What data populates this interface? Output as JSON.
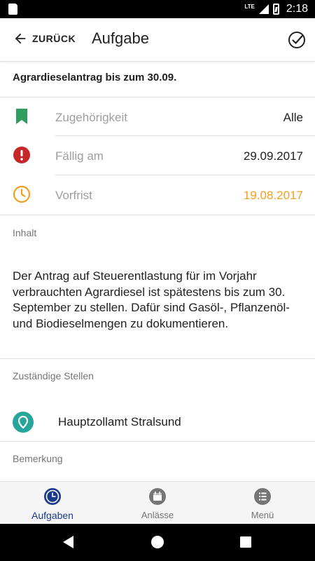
{
  "status_bar": {
    "network": "LTE",
    "time": "2:18"
  },
  "app_bar": {
    "back_label": "ZURÜCK",
    "title": "Aufgabe",
    "action_icon": "check-circle-icon"
  },
  "task": {
    "title": "Agrardieselantrag bis zum 30.09.",
    "rows": [
      {
        "icon": "bookmark-icon",
        "icon_color": "#2e9d5e",
        "label": "Zugehörigkeit",
        "value": "Alle",
        "value_color": "#212121"
      },
      {
        "icon": "alert-icon",
        "icon_color": "#c62828",
        "label": "Fällig am",
        "value": "29.09.2017",
        "value_color": "#212121"
      },
      {
        "icon": "clock-icon",
        "icon_color": "#f0a020",
        "label": "Vorfrist",
        "value": "19.08.2017",
        "value_color": "#f0a020"
      }
    ],
    "content_label": "Inhalt",
    "content_text": "Der Antrag auf Steuerentlastung für im Vorjahr verbrauchten Agrardiesel ist spätestens bis zum 30. September zu stellen. Dafür sind Gasöl-, Pflanzenöl- und Biodieselmengen zu dokumentieren.",
    "responsible_label": "Zuständige Stellen",
    "responsible_name": "Hauptzollamt Stralsund",
    "remark_label": "Bemerkung"
  },
  "bottom_nav": {
    "tabs": [
      {
        "label": "Aufgaben",
        "icon": "clock-icon",
        "active": true
      },
      {
        "label": "Anlässe",
        "icon": "calendar-icon",
        "active": false
      },
      {
        "label": "Menü",
        "icon": "list-icon",
        "active": false
      }
    ]
  },
  "colors": {
    "accent": "#1a3a8c",
    "teal": "#26a69a",
    "warning": "#f0a020",
    "danger": "#c62828",
    "success": "#2e9d5e"
  }
}
